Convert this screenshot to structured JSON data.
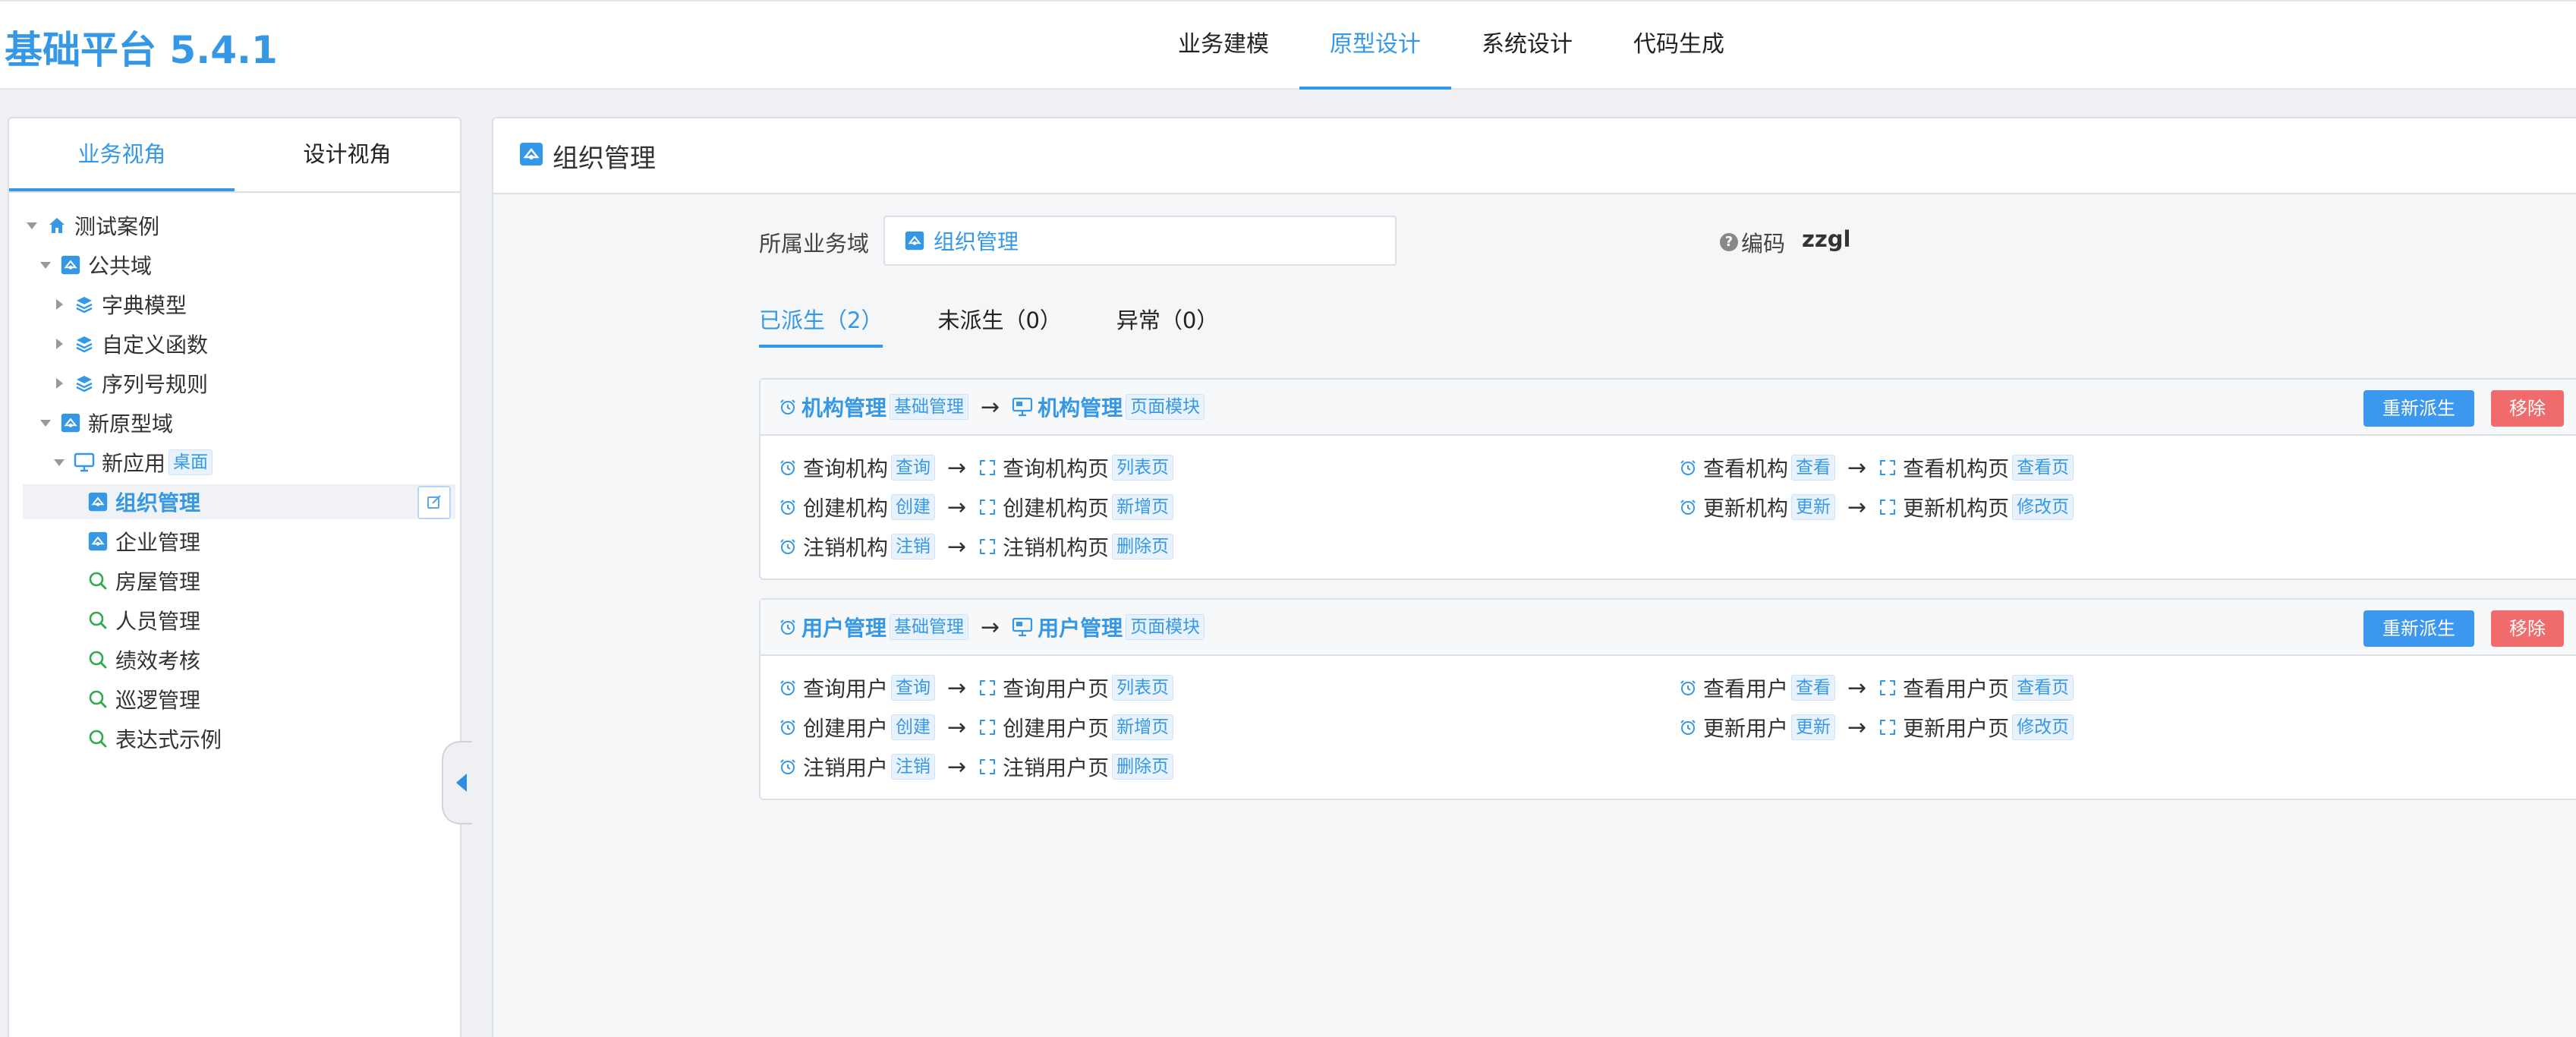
{
  "app": {
    "title": "基础平台 5.4.1"
  },
  "top_nav": [
    {
      "label": "业务建模",
      "active": false
    },
    {
      "label": "原型设计",
      "active": true
    },
    {
      "label": "系统设计",
      "active": false
    },
    {
      "label": "代码生成",
      "active": false
    }
  ],
  "view_tabs": [
    {
      "label": "业务视角",
      "active": true
    },
    {
      "label": "设计视角",
      "active": false
    }
  ],
  "tree": [
    {
      "label": "测试案例",
      "level": 0,
      "caret": "down",
      "icon": "home-icon"
    },
    {
      "label": "公共域",
      "level": 1,
      "caret": "down",
      "icon": "module-icon"
    },
    {
      "label": "字典模型",
      "level": 2,
      "caret": "right",
      "icon": "layers-icon"
    },
    {
      "label": "自定义函数",
      "level": 2,
      "caret": "right",
      "icon": "layers-icon"
    },
    {
      "label": "序列号规则",
      "level": 2,
      "caret": "right",
      "icon": "layers-icon"
    },
    {
      "label": "新原型域",
      "level": 1,
      "caret": "down",
      "icon": "module-icon"
    },
    {
      "label": "新应用",
      "level": 2,
      "caret": "down",
      "icon": "desktop-icon",
      "tag": "桌面"
    },
    {
      "label": "组织管理",
      "level": 3,
      "caret": "none",
      "icon": "module-icon",
      "selected": true
    },
    {
      "label": "企业管理",
      "level": 3,
      "caret": "none",
      "icon": "module-icon"
    },
    {
      "label": "房屋管理",
      "level": 3,
      "caret": "none",
      "icon": "search-icon"
    },
    {
      "label": "人员管理",
      "level": 3,
      "caret": "none",
      "icon": "search-icon"
    },
    {
      "label": "绩效考核",
      "level": 3,
      "caret": "none",
      "icon": "search-icon"
    },
    {
      "label": "巡逻管理",
      "level": 3,
      "caret": "none",
      "icon": "search-icon"
    },
    {
      "label": "表达式示例",
      "level": 3,
      "caret": "none",
      "icon": "search-icon"
    }
  ],
  "main": {
    "title": "组织管理",
    "domain_label": "所属业务域",
    "domain_value": "组织管理",
    "code_label": "编码",
    "code_value": "zzgl",
    "sub_tabs": [
      {
        "label": "已派生（2）",
        "active": true
      },
      {
        "label": "未派生（0）",
        "active": false
      },
      {
        "label": "异常（0）",
        "active": false
      }
    ],
    "cards": [
      {
        "name": "机构管理",
        "tag": "基础管理",
        "target_name": "机构管理",
        "target_tag": "页面模块",
        "btn_rederive": "重新派生",
        "btn_remove": "移除",
        "items": [
          {
            "name": "查询机构",
            "tag": "查询",
            "page": "查询机构页",
            "page_tag": "列表页"
          },
          {
            "name": "查看机构",
            "tag": "查看",
            "page": "查看机构页",
            "page_tag": "查看页"
          },
          {
            "name": "创建机构",
            "tag": "创建",
            "page": "创建机构页",
            "page_tag": "新增页"
          },
          {
            "name": "更新机构",
            "tag": "更新",
            "page": "更新机构页",
            "page_tag": "修改页"
          },
          {
            "name": "注销机构",
            "tag": "注销",
            "page": "注销机构页",
            "page_tag": "删除页"
          }
        ]
      },
      {
        "name": "用户管理",
        "tag": "基础管理",
        "target_name": "用户管理",
        "target_tag": "页面模块",
        "btn_rederive": "重新派生",
        "btn_remove": "移除",
        "items": [
          {
            "name": "查询用户",
            "tag": "查询",
            "page": "查询用户页",
            "page_tag": "列表页"
          },
          {
            "name": "查看用户",
            "tag": "查看",
            "page": "查看用户页",
            "page_tag": "查看页"
          },
          {
            "name": "创建用户",
            "tag": "创建",
            "page": "创建用户页",
            "page_tag": "新增页"
          },
          {
            "name": "更新用户",
            "tag": "更新",
            "page": "更新用户页",
            "page_tag": "修改页"
          },
          {
            "name": "注销用户",
            "tag": "注销",
            "page": "注销用户页",
            "page_tag": "删除页"
          }
        ]
      }
    ]
  },
  "colors": {
    "accent": "#3598e6",
    "tag_bg": "#e8f2fd",
    "danger": "#f06c6c",
    "primary_btn": "#3c97ef"
  }
}
